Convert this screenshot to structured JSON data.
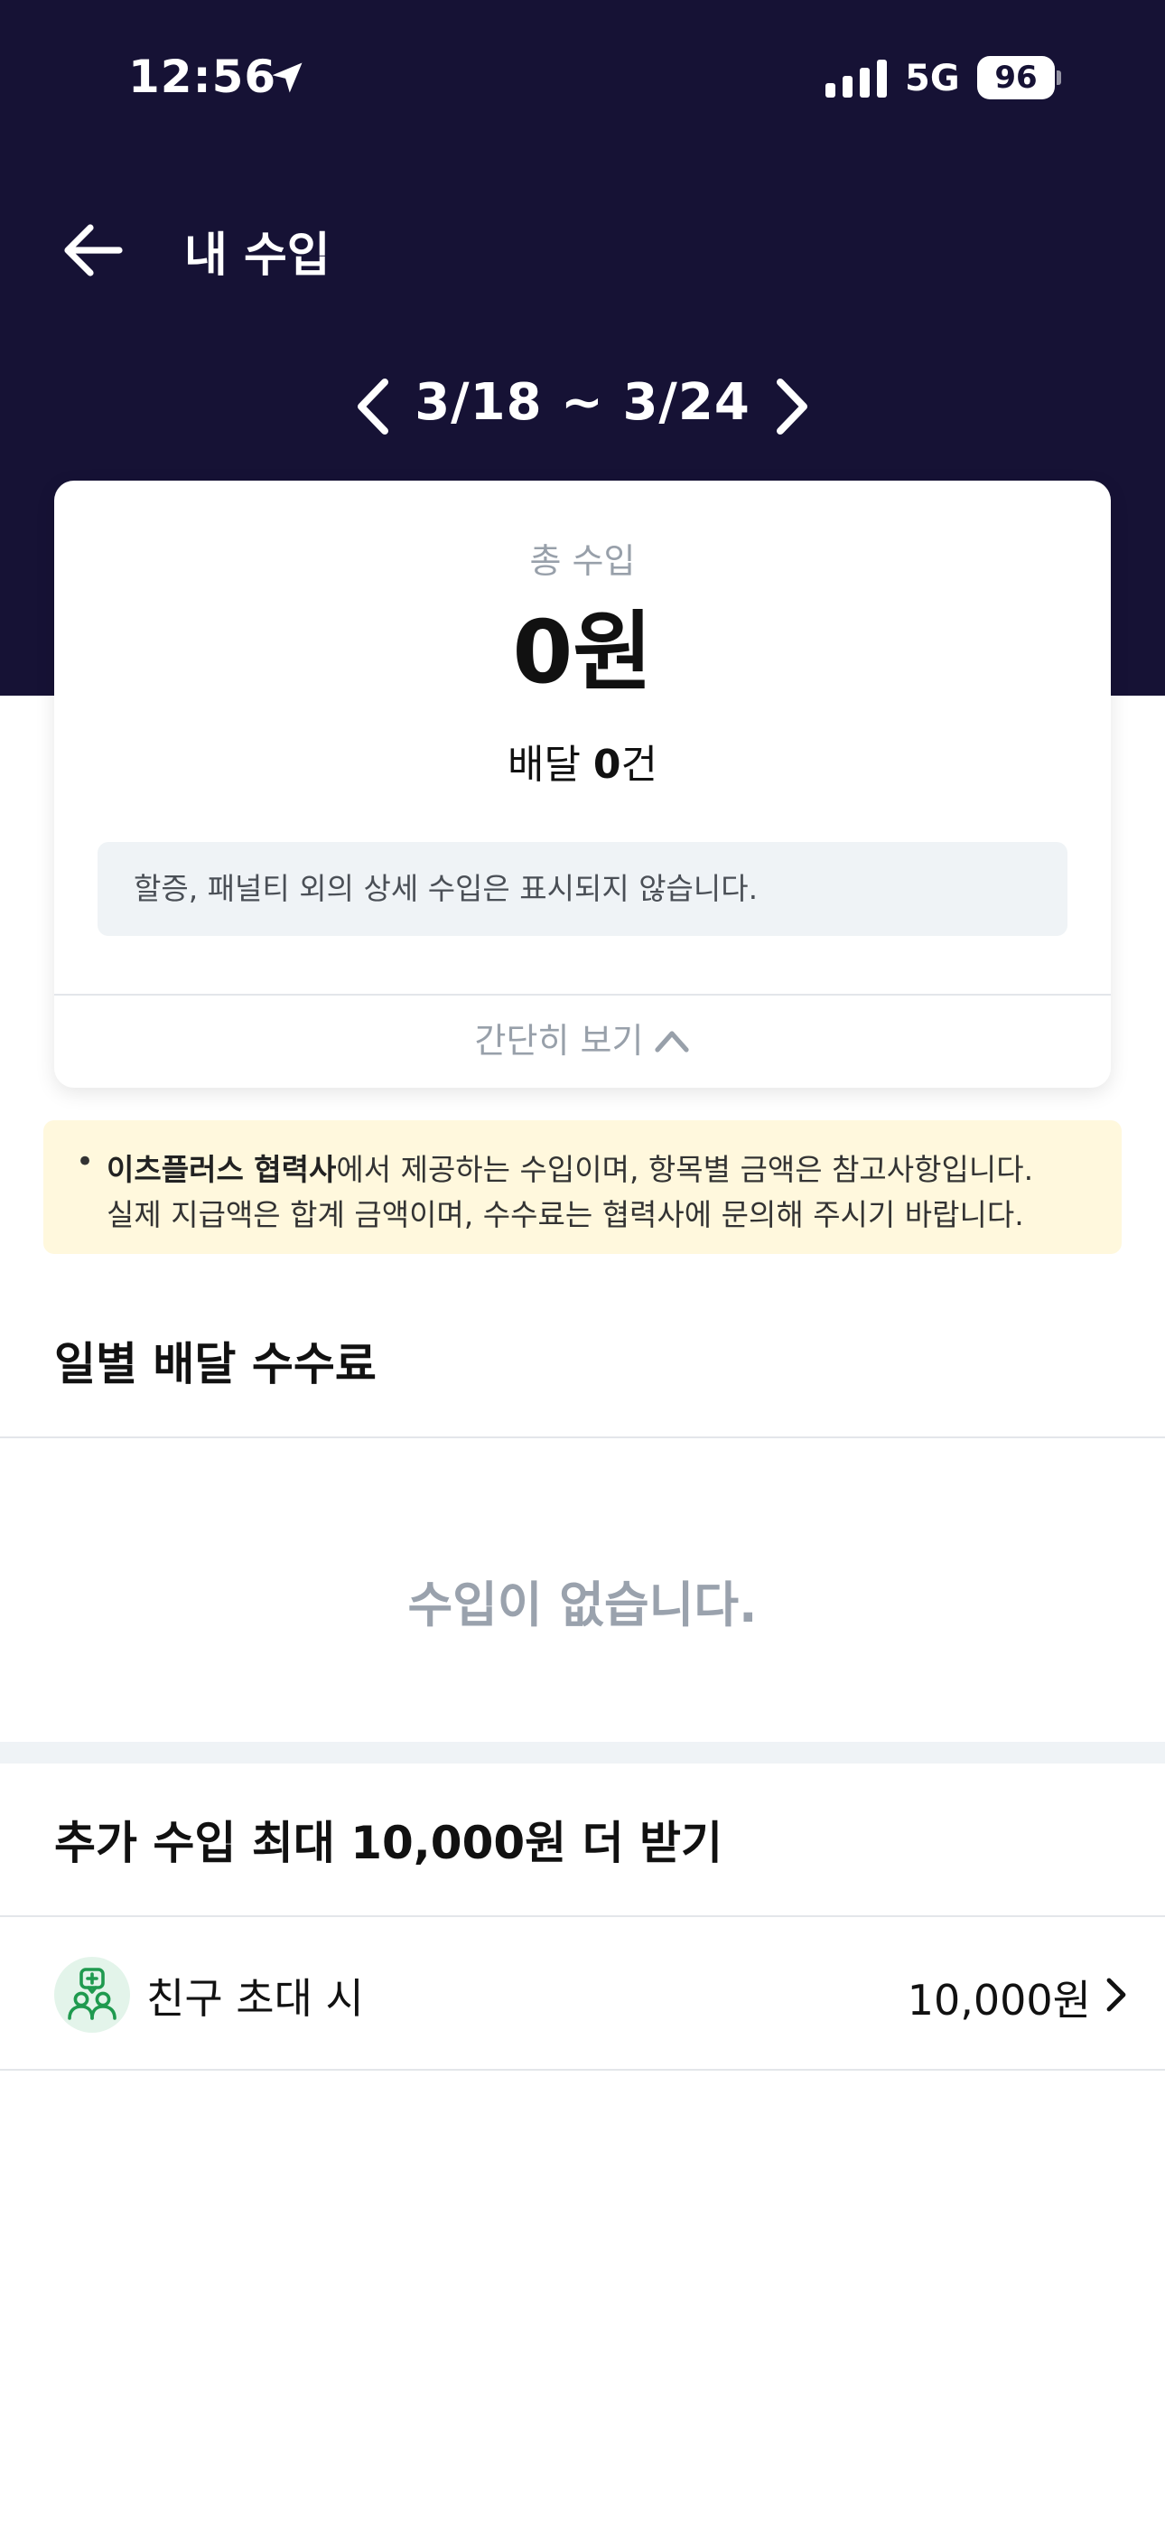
{
  "colors": {
    "header_bg": "#161235",
    "notice_bg": "#eff3f6",
    "info_banner_bg": "#fff8dd",
    "friend_icon_bg": "#e3f4ea",
    "friend_icon_fg": "#1f9a4f",
    "muted_text": "#98a0aa"
  },
  "status_bar": {
    "time": "12:56",
    "network": "5G",
    "battery": "96",
    "icons": [
      "location-arrow-icon",
      "signal-bars-icon",
      "battery-icon"
    ]
  },
  "nav": {
    "title": "내 수입",
    "back_icon": "arrow-left-icon"
  },
  "week": {
    "range": "3/18 ~ 3/24",
    "prev_icon": "chevron-left-icon",
    "next_icon": "chevron-right-icon"
  },
  "summary": {
    "total_label": "총 수입",
    "total_amount": "0원",
    "delivery_prefix": "배달 ",
    "delivery_count": "0",
    "delivery_suffix": "건",
    "notice": "할증, 패널티 외의 상세 수입은 표시되지 않습니다.",
    "collapse_label": "간단히 보기",
    "collapse_icon": "chevron-up-icon"
  },
  "info_banner": {
    "bullet": "•",
    "partner_bold": "이츠플러스 협력사",
    "line1_rest": "에서 제공하는 수입이며, 항목별 금액은 참고사항입니다.",
    "line2": "실제 지급액은 합계 금액이며, 수수료는 협력사에 문의해 주시기 바랍니다."
  },
  "daily_section": {
    "title": "일별 배달 수수료",
    "empty_message": "수입이 없습니다."
  },
  "bonus_section": {
    "title": "추가 수입 최대 10,000원 더 받기",
    "items": [
      {
        "label": "친구 초대 시",
        "amount": "10,000원",
        "icon": "invite-friends-icon"
      }
    ]
  }
}
